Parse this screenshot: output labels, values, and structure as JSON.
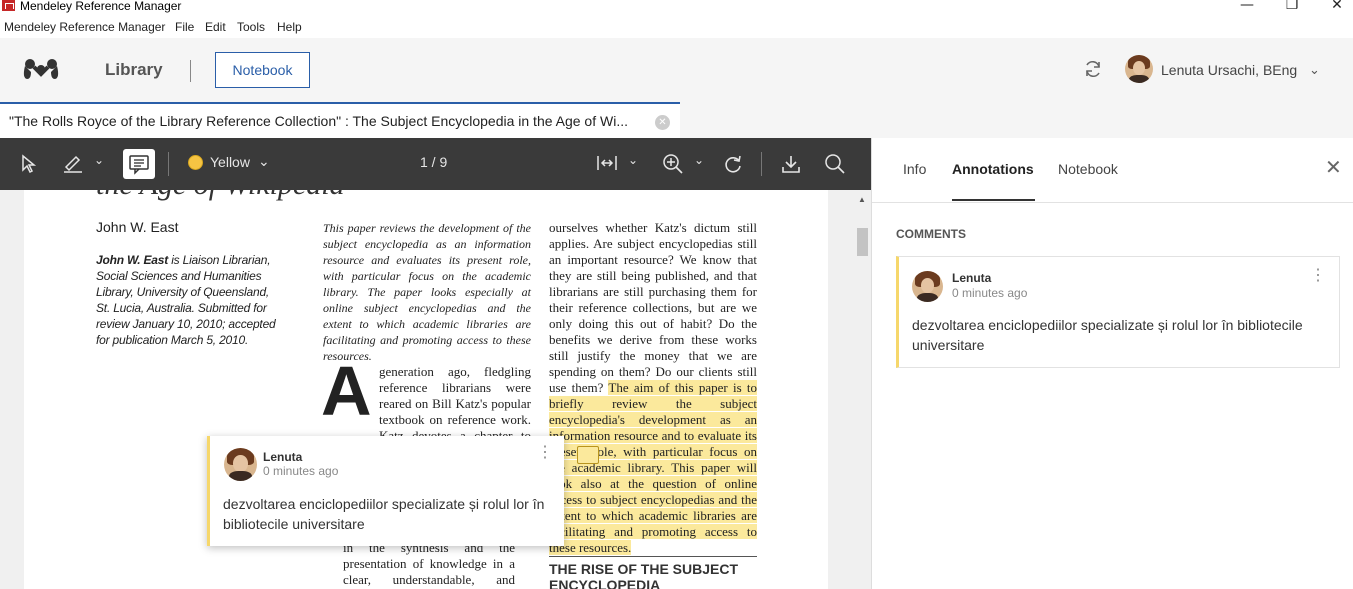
{
  "window": {
    "title": "Mendeley Reference Manager",
    "minimize": "—",
    "maximize": "❐",
    "close": "✕"
  },
  "menu": [
    "Mendeley Reference Manager",
    "File",
    "Edit",
    "Tools",
    "Help"
  ],
  "header": {
    "library": "Library",
    "notebook": "Notebook",
    "user_name": "Lenuta Ursachi, BEng"
  },
  "doc_tab": {
    "title": "\"The Rolls Royce of the Library Reference Collection\" : The Subject Encyclopedia in the Age of Wi..."
  },
  "toolbar": {
    "color": "Yellow",
    "page": "1 / 9"
  },
  "pdf": {
    "heading_fragment": "the Age of Wikipedia",
    "author": "John W. East",
    "bio_bold": "John W. East",
    "bio": " is Liaison Librarian, Social Sciences and Humanities Library, University of Queensland, St. Lucia, Australia. Submitted for review January 10, 2010; accepted for publication March 5, 2010.",
    "abstract": "This paper reviews the development of the subject encyclopedia as an information resource and evaluates its present role, with particular focus on the academic library. The paper looks especially at online subject encyclopedias and the extent to which academic libraries are facilitating and promoting access to these resources.",
    "dropcap": "A",
    "para1": "generation ago, fledgling reference librarians were reared on Bill Katz's popular textbook on reference work. Katz devotes a chapter to encyclope-",
    "col2_tail": "in the synthesis and the presentation of knowledge in a clear, understandable, and intelligent",
    "col3_plain": "ourselves whether Katz's dictum still applies. Are subject encyclopedias still an important resource? We know that they are still being published, and that librarians are still purchasing them for their reference collections, but are we only doing this out of habit? Do the benefits we derive from these works still justify the money that we are spending on them? Do our clients still use them?",
    "col3_highlight": "The aim of this paper is to briefly review the subject encyclopedia's development as an information resource and to evaluate its present role, with particular focus on the academic library. This paper will look also at the question of online access to subject encyclopedias and the extent to which academic libraries are facilitating and promoting access to these resources.",
    "section_heading": "THE RISE OF THE SUBJECT ENCYCLOPEDIA"
  },
  "popup": {
    "author": "Lenuta",
    "time": "0 minutes ago",
    "text": "dezvoltarea enciclopediilor specializate și rolul lor în bibliotecile universitare"
  },
  "panel": {
    "tabs": [
      "Info",
      "Annotations",
      "Notebook"
    ],
    "section": "COMMENTS",
    "comment": {
      "author": "Lenuta",
      "time": "0 minutes ago",
      "text": "dezvoltarea enciclopediilor specializate și rolul lor în bibliotecile universitare"
    }
  }
}
